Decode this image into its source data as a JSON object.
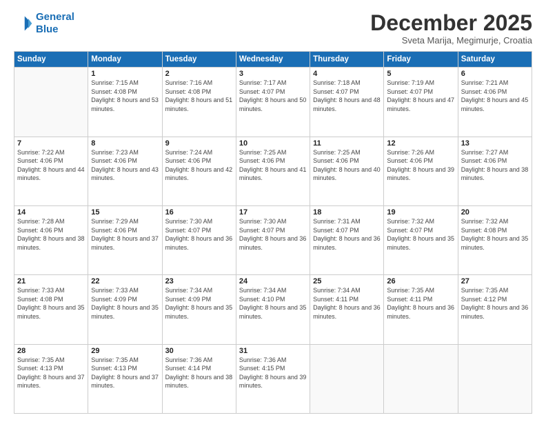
{
  "logo": {
    "line1": "General",
    "line2": "Blue"
  },
  "header": {
    "month": "December 2025",
    "location": "Sveta Marija, Megimurje, Croatia"
  },
  "days_of_week": [
    "Sunday",
    "Monday",
    "Tuesday",
    "Wednesday",
    "Thursday",
    "Friday",
    "Saturday"
  ],
  "weeks": [
    [
      {
        "day": "",
        "sunrise": "",
        "sunset": "",
        "daylight": ""
      },
      {
        "day": "1",
        "sunrise": "Sunrise: 7:15 AM",
        "sunset": "Sunset: 4:08 PM",
        "daylight": "Daylight: 8 hours and 53 minutes."
      },
      {
        "day": "2",
        "sunrise": "Sunrise: 7:16 AM",
        "sunset": "Sunset: 4:08 PM",
        "daylight": "Daylight: 8 hours and 51 minutes."
      },
      {
        "day": "3",
        "sunrise": "Sunrise: 7:17 AM",
        "sunset": "Sunset: 4:07 PM",
        "daylight": "Daylight: 8 hours and 50 minutes."
      },
      {
        "day": "4",
        "sunrise": "Sunrise: 7:18 AM",
        "sunset": "Sunset: 4:07 PM",
        "daylight": "Daylight: 8 hours and 48 minutes."
      },
      {
        "day": "5",
        "sunrise": "Sunrise: 7:19 AM",
        "sunset": "Sunset: 4:07 PM",
        "daylight": "Daylight: 8 hours and 47 minutes."
      },
      {
        "day": "6",
        "sunrise": "Sunrise: 7:21 AM",
        "sunset": "Sunset: 4:06 PM",
        "daylight": "Daylight: 8 hours and 45 minutes."
      }
    ],
    [
      {
        "day": "7",
        "sunrise": "Sunrise: 7:22 AM",
        "sunset": "Sunset: 4:06 PM",
        "daylight": "Daylight: 8 hours and 44 minutes."
      },
      {
        "day": "8",
        "sunrise": "Sunrise: 7:23 AM",
        "sunset": "Sunset: 4:06 PM",
        "daylight": "Daylight: 8 hours and 43 minutes."
      },
      {
        "day": "9",
        "sunrise": "Sunrise: 7:24 AM",
        "sunset": "Sunset: 4:06 PM",
        "daylight": "Daylight: 8 hours and 42 minutes."
      },
      {
        "day": "10",
        "sunrise": "Sunrise: 7:25 AM",
        "sunset": "Sunset: 4:06 PM",
        "daylight": "Daylight: 8 hours and 41 minutes."
      },
      {
        "day": "11",
        "sunrise": "Sunrise: 7:25 AM",
        "sunset": "Sunset: 4:06 PM",
        "daylight": "Daylight: 8 hours and 40 minutes."
      },
      {
        "day": "12",
        "sunrise": "Sunrise: 7:26 AM",
        "sunset": "Sunset: 4:06 PM",
        "daylight": "Daylight: 8 hours and 39 minutes."
      },
      {
        "day": "13",
        "sunrise": "Sunrise: 7:27 AM",
        "sunset": "Sunset: 4:06 PM",
        "daylight": "Daylight: 8 hours and 38 minutes."
      }
    ],
    [
      {
        "day": "14",
        "sunrise": "Sunrise: 7:28 AM",
        "sunset": "Sunset: 4:06 PM",
        "daylight": "Daylight: 8 hours and 38 minutes."
      },
      {
        "day": "15",
        "sunrise": "Sunrise: 7:29 AM",
        "sunset": "Sunset: 4:06 PM",
        "daylight": "Daylight: 8 hours and 37 minutes."
      },
      {
        "day": "16",
        "sunrise": "Sunrise: 7:30 AM",
        "sunset": "Sunset: 4:07 PM",
        "daylight": "Daylight: 8 hours and 36 minutes."
      },
      {
        "day": "17",
        "sunrise": "Sunrise: 7:30 AM",
        "sunset": "Sunset: 4:07 PM",
        "daylight": "Daylight: 8 hours and 36 minutes."
      },
      {
        "day": "18",
        "sunrise": "Sunrise: 7:31 AM",
        "sunset": "Sunset: 4:07 PM",
        "daylight": "Daylight: 8 hours and 36 minutes."
      },
      {
        "day": "19",
        "sunrise": "Sunrise: 7:32 AM",
        "sunset": "Sunset: 4:07 PM",
        "daylight": "Daylight: 8 hours and 35 minutes."
      },
      {
        "day": "20",
        "sunrise": "Sunrise: 7:32 AM",
        "sunset": "Sunset: 4:08 PM",
        "daylight": "Daylight: 8 hours and 35 minutes."
      }
    ],
    [
      {
        "day": "21",
        "sunrise": "Sunrise: 7:33 AM",
        "sunset": "Sunset: 4:08 PM",
        "daylight": "Daylight: 8 hours and 35 minutes."
      },
      {
        "day": "22",
        "sunrise": "Sunrise: 7:33 AM",
        "sunset": "Sunset: 4:09 PM",
        "daylight": "Daylight: 8 hours and 35 minutes."
      },
      {
        "day": "23",
        "sunrise": "Sunrise: 7:34 AM",
        "sunset": "Sunset: 4:09 PM",
        "daylight": "Daylight: 8 hours and 35 minutes."
      },
      {
        "day": "24",
        "sunrise": "Sunrise: 7:34 AM",
        "sunset": "Sunset: 4:10 PM",
        "daylight": "Daylight: 8 hours and 35 minutes."
      },
      {
        "day": "25",
        "sunrise": "Sunrise: 7:34 AM",
        "sunset": "Sunset: 4:11 PM",
        "daylight": "Daylight: 8 hours and 36 minutes."
      },
      {
        "day": "26",
        "sunrise": "Sunrise: 7:35 AM",
        "sunset": "Sunset: 4:11 PM",
        "daylight": "Daylight: 8 hours and 36 minutes."
      },
      {
        "day": "27",
        "sunrise": "Sunrise: 7:35 AM",
        "sunset": "Sunset: 4:12 PM",
        "daylight": "Daylight: 8 hours and 36 minutes."
      }
    ],
    [
      {
        "day": "28",
        "sunrise": "Sunrise: 7:35 AM",
        "sunset": "Sunset: 4:13 PM",
        "daylight": "Daylight: 8 hours and 37 minutes."
      },
      {
        "day": "29",
        "sunrise": "Sunrise: 7:35 AM",
        "sunset": "Sunset: 4:13 PM",
        "daylight": "Daylight: 8 hours and 37 minutes."
      },
      {
        "day": "30",
        "sunrise": "Sunrise: 7:36 AM",
        "sunset": "Sunset: 4:14 PM",
        "daylight": "Daylight: 8 hours and 38 minutes."
      },
      {
        "day": "31",
        "sunrise": "Sunrise: 7:36 AM",
        "sunset": "Sunset: 4:15 PM",
        "daylight": "Daylight: 8 hours and 39 minutes."
      },
      {
        "day": "",
        "sunrise": "",
        "sunset": "",
        "daylight": ""
      },
      {
        "day": "",
        "sunrise": "",
        "sunset": "",
        "daylight": ""
      },
      {
        "day": "",
        "sunrise": "",
        "sunset": "",
        "daylight": ""
      }
    ]
  ]
}
